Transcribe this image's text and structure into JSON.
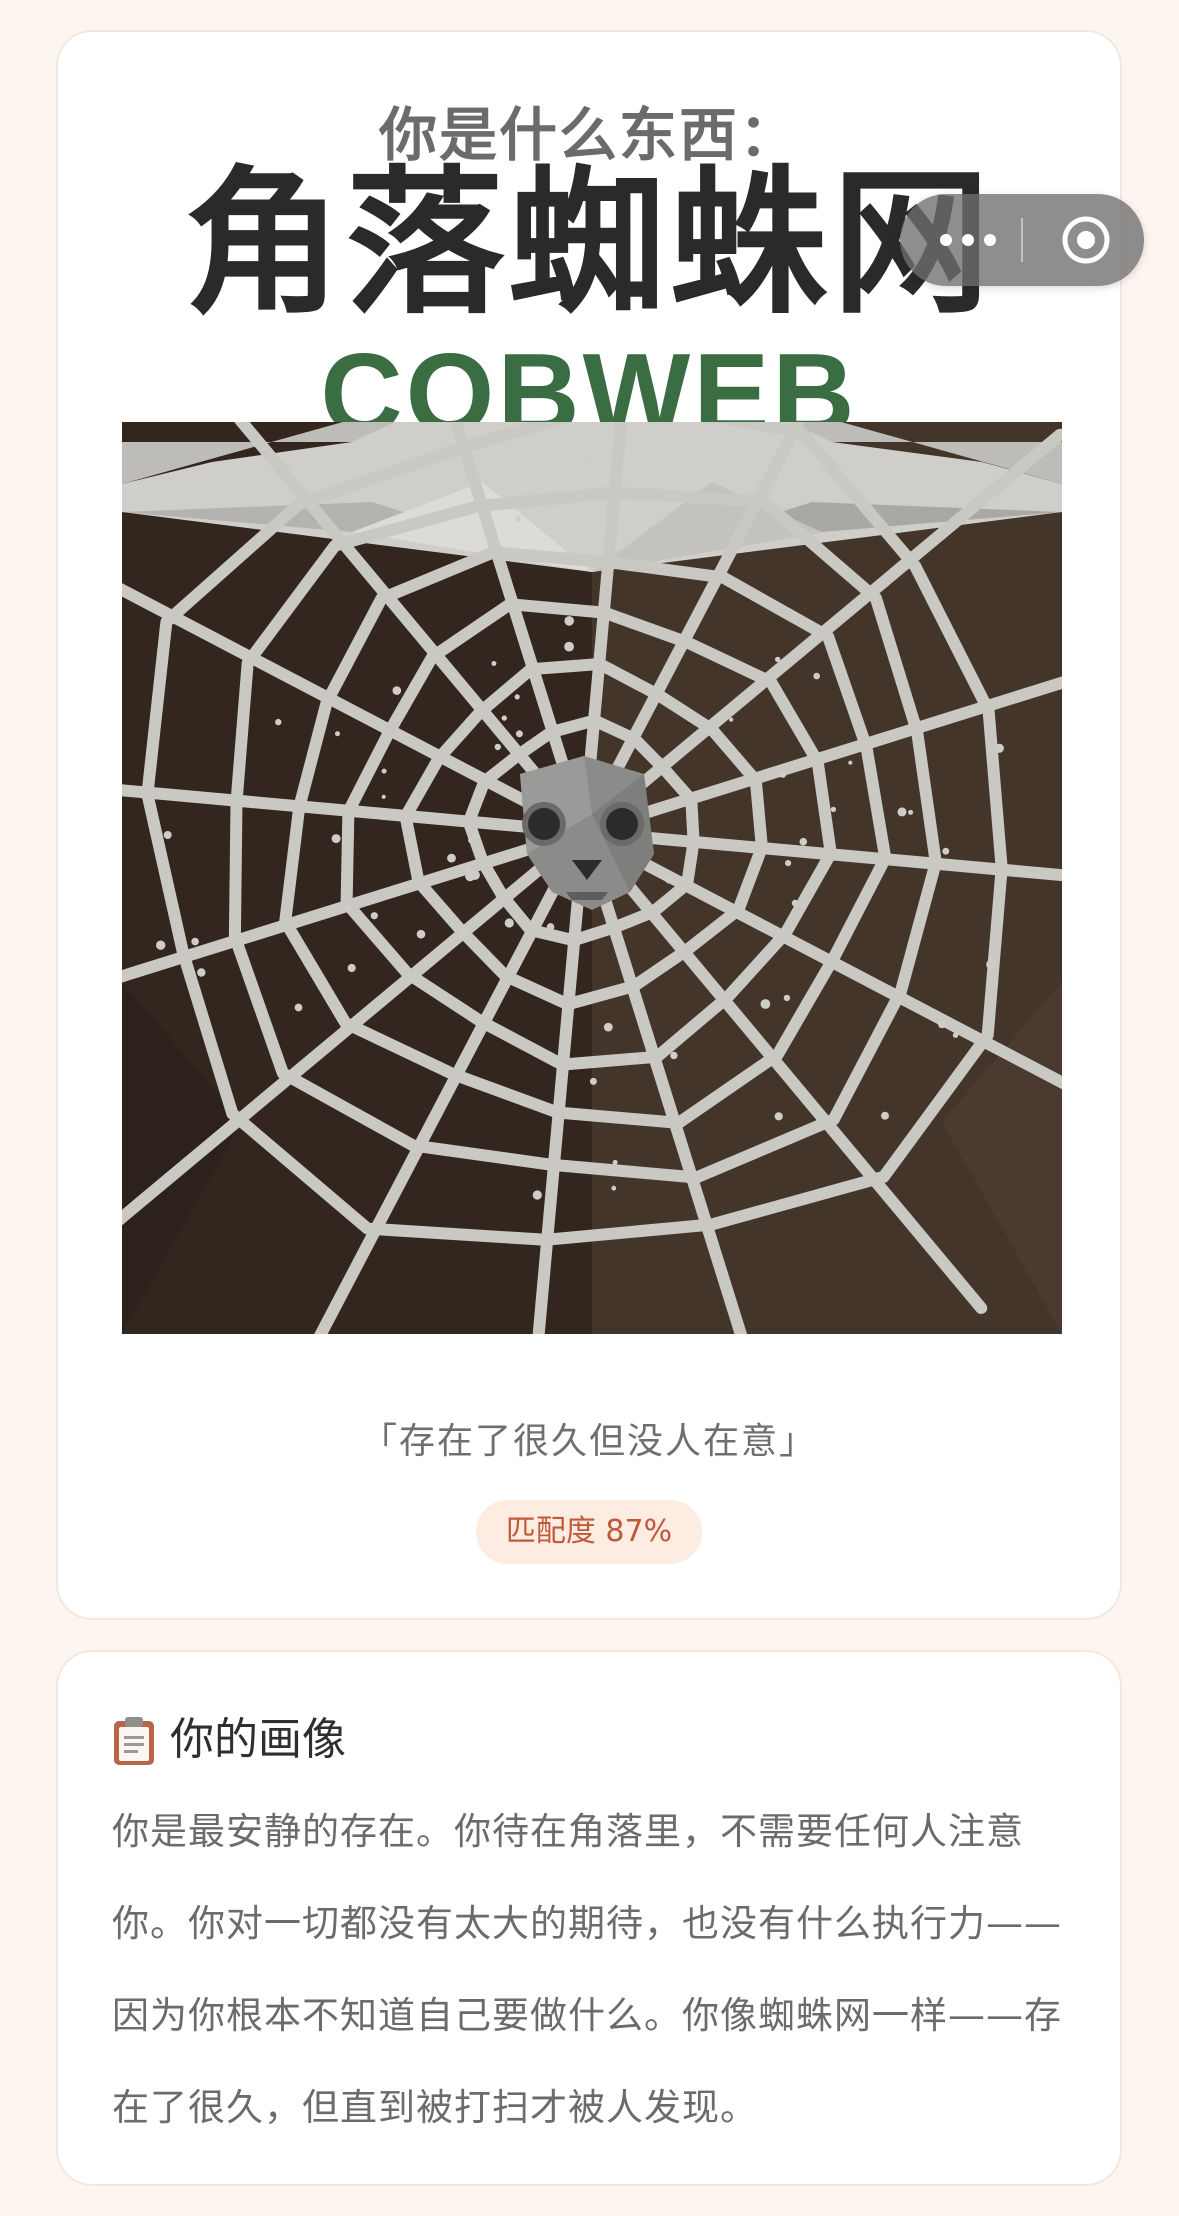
{
  "result": {
    "overline": "你是什么东西：",
    "title": "角落蜘蛛网",
    "subtitle": "COBWEB",
    "quote": "「存在了很久但没人在意」",
    "match_label": "匹配度 87%",
    "match_percent": 87
  },
  "capsule": {
    "more_icon": "more-dots-icon",
    "close_icon": "target-circle-icon"
  },
  "portrait": {
    "icon": "clipboard-icon",
    "title": "你的画像",
    "body": "你是最安静的存在。你待在角落里，不需要任何人注意你。你对一切都没有太大的期待，也没有什么执行力——因为你根本不知道自己要做什么。你像蜘蛛网一样——存在了很久，但直到被打扫才被人发现。"
  },
  "colors": {
    "page_bg": "#fdf5ef",
    "title": "#2a2a2a",
    "subtitle_green": "#3b6d43",
    "badge_bg": "#fcece2",
    "badge_text": "#c0593a"
  }
}
